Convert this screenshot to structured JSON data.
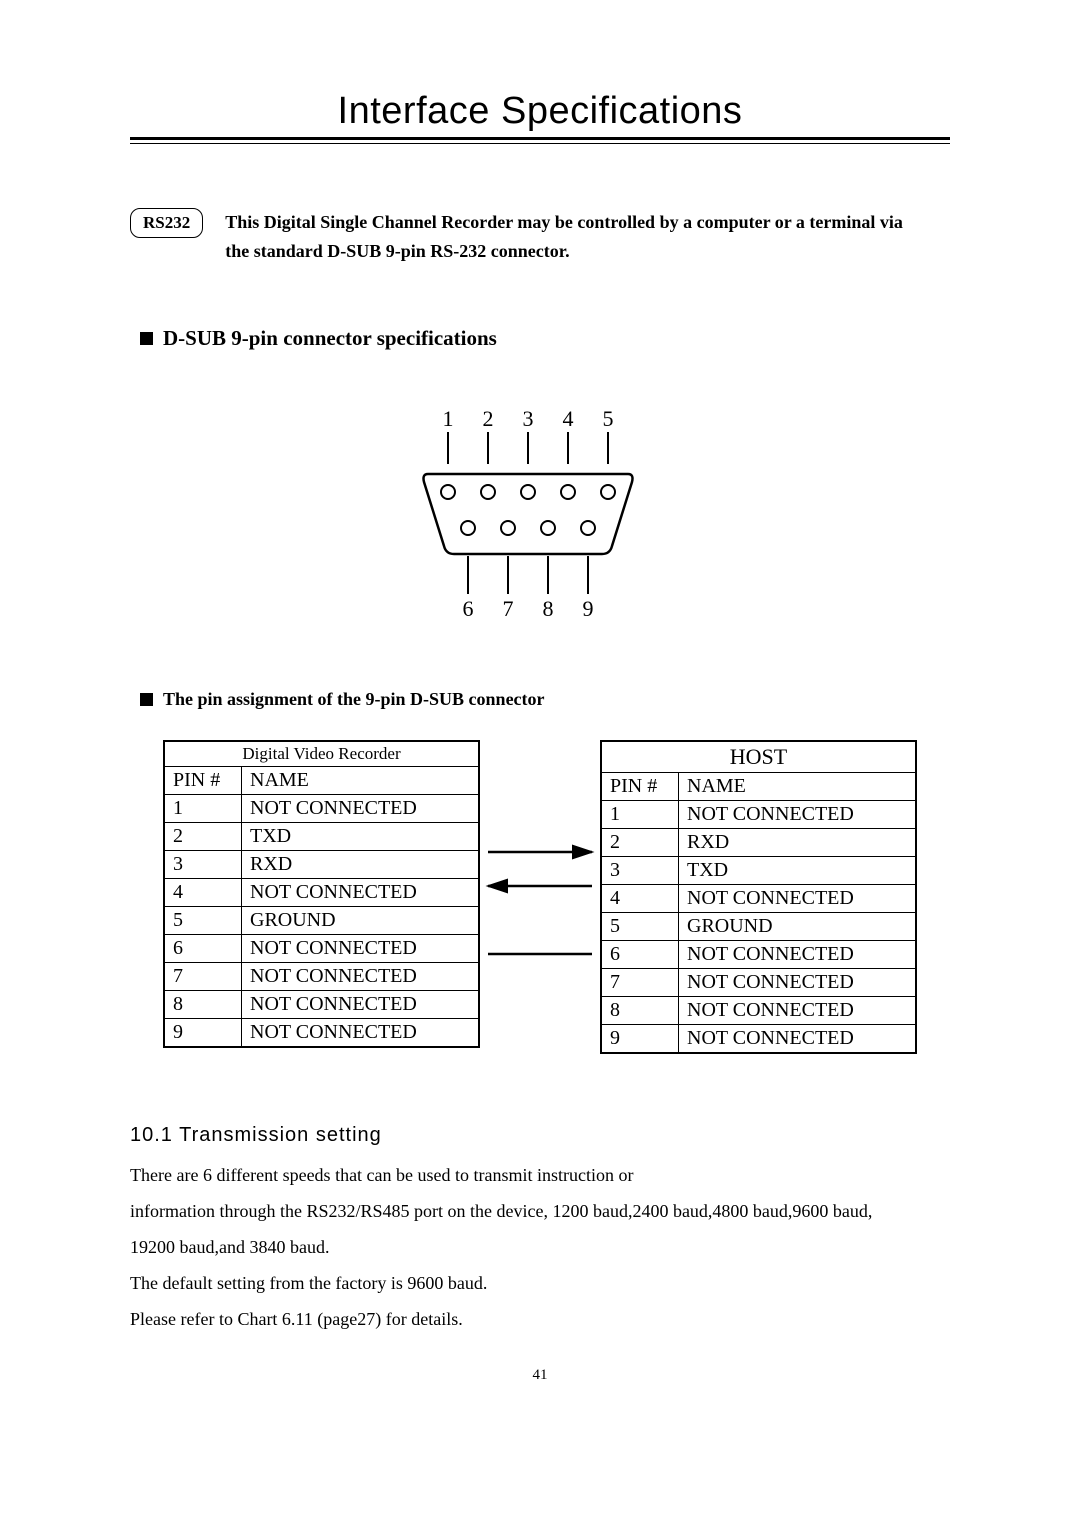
{
  "title": "Interface Specifications",
  "rs232": {
    "badge": "RS232",
    "desc_line1": "This Digital Single Channel Recorder may be controlled by a computer or a terminal via",
    "desc_line2": "the standard D-SUB 9-pin RS-232 connector."
  },
  "bullet1": "D-SUB 9-pin connector specifications",
  "dsub": {
    "top_pins": [
      "1",
      "2",
      "3",
      "4",
      "5"
    ],
    "bottom_pins": [
      "6",
      "7",
      "8",
      "9"
    ]
  },
  "bullet2": "The pin assignment of the 9-pin D-SUB connector",
  "tables": {
    "left": {
      "title": "Digital Video Recorder",
      "col1": "PIN #",
      "col2": "NAME",
      "rows": [
        {
          "pin": "1",
          "name": "NOT CONNECTED"
        },
        {
          "pin": "2",
          "name": "TXD"
        },
        {
          "pin": "3",
          "name": "RXD"
        },
        {
          "pin": "4",
          "name": "NOT CONNECTED"
        },
        {
          "pin": "5",
          "name": "GROUND"
        },
        {
          "pin": "6",
          "name": "NOT CONNECTED"
        },
        {
          "pin": "7",
          "name": "NOT CONNECTED"
        },
        {
          "pin": "8",
          "name": "NOT CONNECTED"
        },
        {
          "pin": "9",
          "name": "NOT CONNECTED"
        }
      ]
    },
    "right": {
      "title": "HOST",
      "col1": "PIN #",
      "col2": "NAME",
      "rows": [
        {
          "pin": "1",
          "name": "NOT CONNECTED"
        },
        {
          "pin": "2",
          "name": "RXD"
        },
        {
          "pin": "3",
          "name": "TXD"
        },
        {
          "pin": "4",
          "name": "NOT CONNECTED"
        },
        {
          "pin": "5",
          "name": "GROUND"
        },
        {
          "pin": "6",
          "name": "NOT CONNECTED"
        },
        {
          "pin": "7",
          "name": "NOT CONNECTED"
        },
        {
          "pin": "8",
          "name": "NOT CONNECTED"
        },
        {
          "pin": "9",
          "name": "NOT CONNECTED"
        }
      ]
    }
  },
  "section_10_1": {
    "heading": "10.1 Transmission setting",
    "p1": "There are 6 different speeds that can be used to transmit instruction or",
    "p2": "information through the RS232/RS485 port on the device, 1200 baud,2400 baud,4800 baud,9600 baud,",
    "p3": "19200 baud,and 3840 baud.",
    "p4": "The default setting from the factory is 9600 baud.",
    "p5": "Please refer to Chart 6.11 (page27) for details."
  },
  "page_number": "41"
}
